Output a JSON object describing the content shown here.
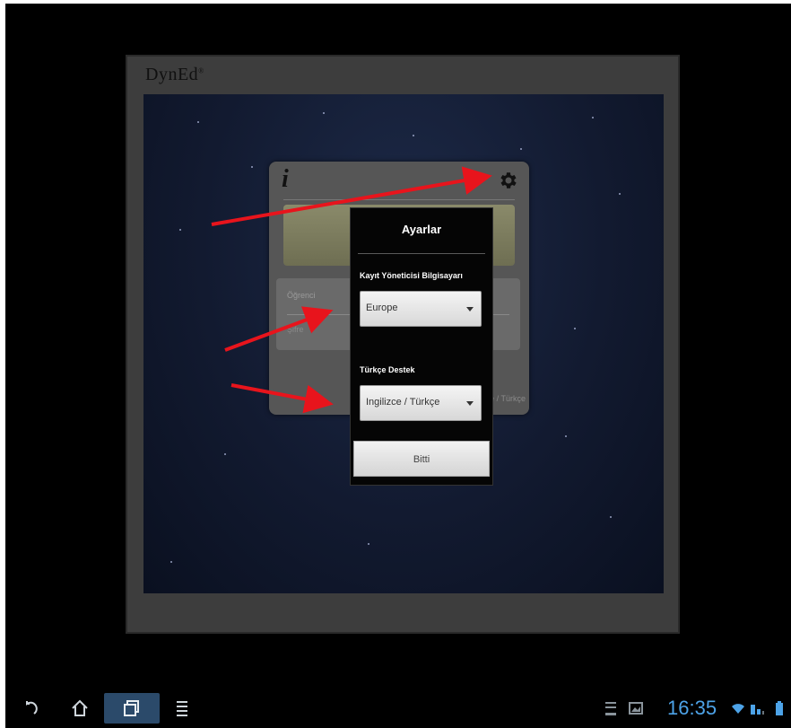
{
  "app": {
    "logo": "DynEd",
    "logo_mark": "®"
  },
  "login": {
    "student_label": "Öğrenci ",
    "student_sub": "Şifre",
    "lang_hint": "İngilizce / Türkçe"
  },
  "settings": {
    "title": "Ayarlar",
    "registration_label": "Kayıt Yöneticisi Bilgisayarı",
    "registration_value": "Europe",
    "support_label": "Türkçe Destek",
    "support_value": "Ingilizce / Türkçe",
    "done_label": "Bitti"
  },
  "annotations": {
    "arrow_color": "#e8141c"
  },
  "status_bar": {
    "time": "16:35",
    "accent_color": "#4da3e8"
  },
  "icons": {
    "nav": [
      "back-icon",
      "home-icon",
      "recent-apps-icon",
      "menu-icon"
    ],
    "status": [
      "download-icon",
      "gallery-icon",
      "wifi-icon",
      "battery-icon"
    ],
    "card": [
      "info-icon",
      "gear-icon"
    ]
  }
}
